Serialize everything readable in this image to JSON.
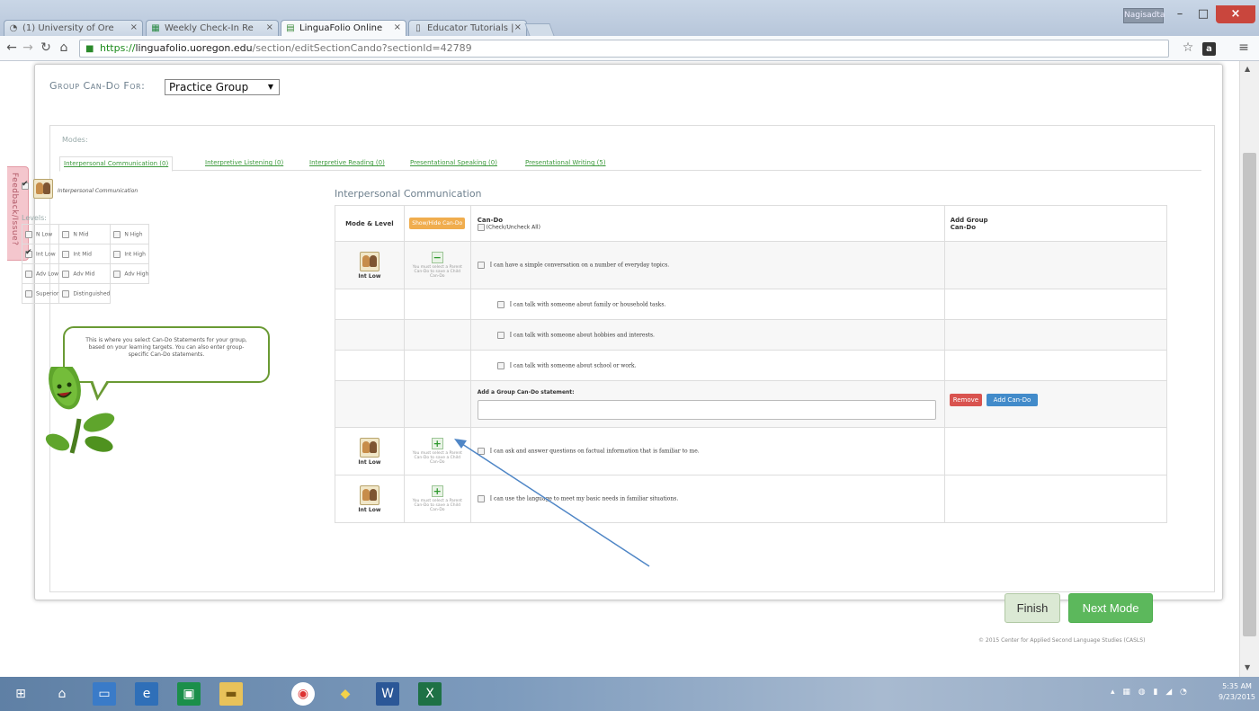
{
  "browser": {
    "tabs": [
      {
        "title": "(1) University of Ore",
        "icon": "ask-icon",
        "active": false
      },
      {
        "title": "Weekly Check-In Re",
        "icon": "sheet-icon",
        "active": false
      },
      {
        "title": "LinguaFolio Online",
        "icon": "lf-icon",
        "active": true
      },
      {
        "title": "Educator Tutorials |",
        "icon": "doc-icon",
        "active": false
      }
    ],
    "user_badge": "Nagisadta",
    "url_protocol": "https://",
    "url_host": "linguafolio.uoregon.edu",
    "url_path": "/section/editSectionCando?sectionId=42789"
  },
  "feedback_tab": "Feedback/Issue?",
  "page": {
    "group_header": "Group Can-Do For:",
    "group_selected": "Practice Group",
    "modes_label": "Modes:",
    "mode_tabs": [
      "Interpersonal Communication (0)",
      "Interpretive Listening (0)",
      "Interpretive Reading (0)",
      "Presentational Speaking (0)",
      "Presentational Writing (5)"
    ],
    "left": {
      "mode_name": "Interpersonal Communication",
      "levels_label": "Levels:",
      "levels": [
        [
          "N Low",
          "N Mid",
          "N High"
        ],
        [
          "Int Low",
          "Int Mid",
          "Int High"
        ],
        [
          "Adv Low",
          "Adv Mid",
          "Adv High"
        ],
        [
          "Superior",
          "Distinguished"
        ]
      ],
      "checked_level": "Int Low"
    },
    "bubble_text": "This is where you select Can-Do Statements for your group, based on your learning targets. You can also enter group-specific Can-Do statements.",
    "right": {
      "title": "Interpersonal Communication",
      "col_mode_level": "Mode & Level",
      "show_hide": "Show/Hide Can-Do",
      "col_cando": "Can-Do",
      "check_all": "(Check/Uncheck All)",
      "col_add_group": "Add Group Can-Do",
      "level_text": "Int Low",
      "parent_hint": "You must select a Parent Can-Do to save a Child Can-Do",
      "parents": [
        "I can have a simple conversation on a number of everyday topics.",
        "I can ask and answer questions on factual information that is familiar to me.",
        "I can use the language to meet my basic needs in familiar situations."
      ],
      "children": [
        "I can talk with someone about family or household tasks.",
        "I can talk with someone about hobbies and interests.",
        "I can talk with someone about school or work."
      ],
      "add_label": "Add a Group Can-Do statement:",
      "remove_btn": "Remove",
      "add_btn": "Add Can-Do"
    },
    "finish_btn": "Finish",
    "next_btn": "Next Mode",
    "footer": "© 2015 Center for Applied Second Language Studies (CASLS)"
  },
  "taskbar": {
    "clock_time": "5:35 AM",
    "clock_date": "9/23/2015"
  },
  "colors": {
    "accent_green": "#5cb85c",
    "remove_red": "#d9534f",
    "add_blue": "#428bca",
    "show_hide_orange": "#f0ad4e",
    "annotation_arrow": "#4f86c6"
  }
}
